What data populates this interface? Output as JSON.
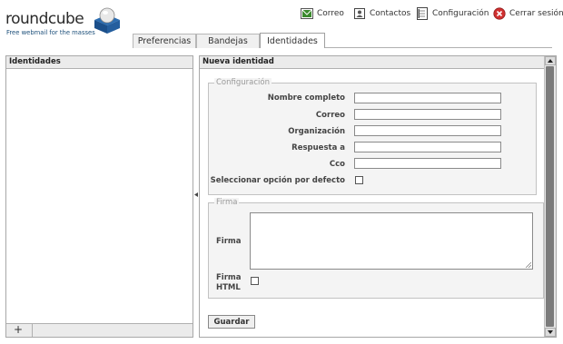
{
  "brand": {
    "name": "roundcube",
    "tagline": "Free webmail for the masses"
  },
  "topnav": {
    "mail": {
      "label": "Correo",
      "icon": "mail-icon"
    },
    "contacts": {
      "label": "Contactos",
      "icon": "contacts-icon"
    },
    "settings": {
      "label": "Configuración",
      "icon": "settings-icon"
    },
    "logout": {
      "label": "Cerrar sesión",
      "icon": "logout-icon"
    }
  },
  "tabs": [
    {
      "label": "Preferencias",
      "active": false
    },
    {
      "label": "Bandejas",
      "active": false
    },
    {
      "label": "Identidades",
      "active": true
    }
  ],
  "left_panel": {
    "title": "Identidades",
    "add_label": "+"
  },
  "right_panel": {
    "title": "Nueva identidad",
    "config": {
      "legend": "Configuración",
      "fields": [
        {
          "label": "Nombre completo",
          "value": ""
        },
        {
          "label": "Correo",
          "value": ""
        },
        {
          "label": "Organización",
          "value": ""
        },
        {
          "label": "Respuesta a",
          "value": ""
        },
        {
          "label": "Cco",
          "value": ""
        }
      ],
      "default_label": "Seleccionar opción por defecto",
      "default_checked": false
    },
    "signature": {
      "legend": "Firma",
      "label": "Firma",
      "value": "",
      "html_label_line1": "Firma",
      "html_label_line2": "HTML",
      "html_checked": false
    },
    "save_label": "Guardar"
  },
  "colors": {
    "panel_header_bg": "#ebebeb",
    "fieldset_bg": "#f4f4f4",
    "logout_red": "#d03030",
    "mail_green": "#3b8a2e"
  }
}
